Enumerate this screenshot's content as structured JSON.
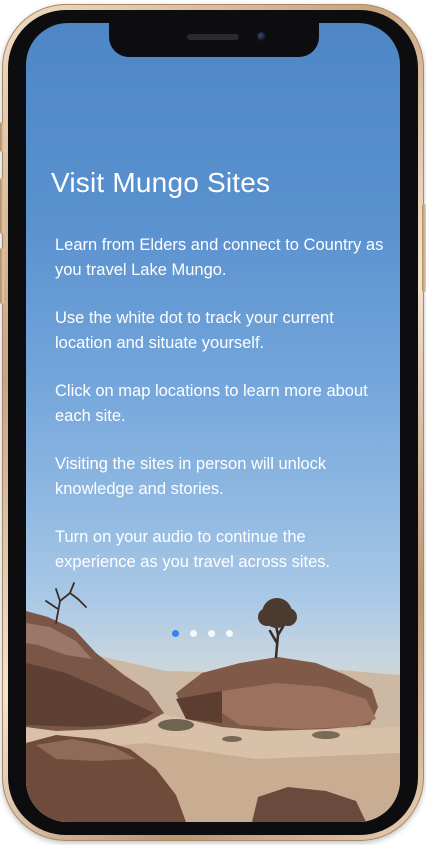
{
  "onboarding": {
    "title": "Visit Mungo Sites",
    "instructions": [
      "Learn from Elders and connect to Country as you travel Lake Mungo.",
      "Use the white dot to track your current location and situate yourself.",
      "Click on map locations to learn more about each site.",
      "Visiting the sites in person will unlock knowledge and stories.",
      "Turn on your audio to continue the experience as you travel across sites."
    ],
    "pagination": {
      "total_pages": 4,
      "active_page": 1
    }
  },
  "colors": {
    "sky_top": "#4f86c6",
    "text": "#ffffff",
    "active_dot": "#2f87e6",
    "frame_gold": "#d9b894"
  },
  "icons": {
    "front_camera": "camera-icon"
  }
}
